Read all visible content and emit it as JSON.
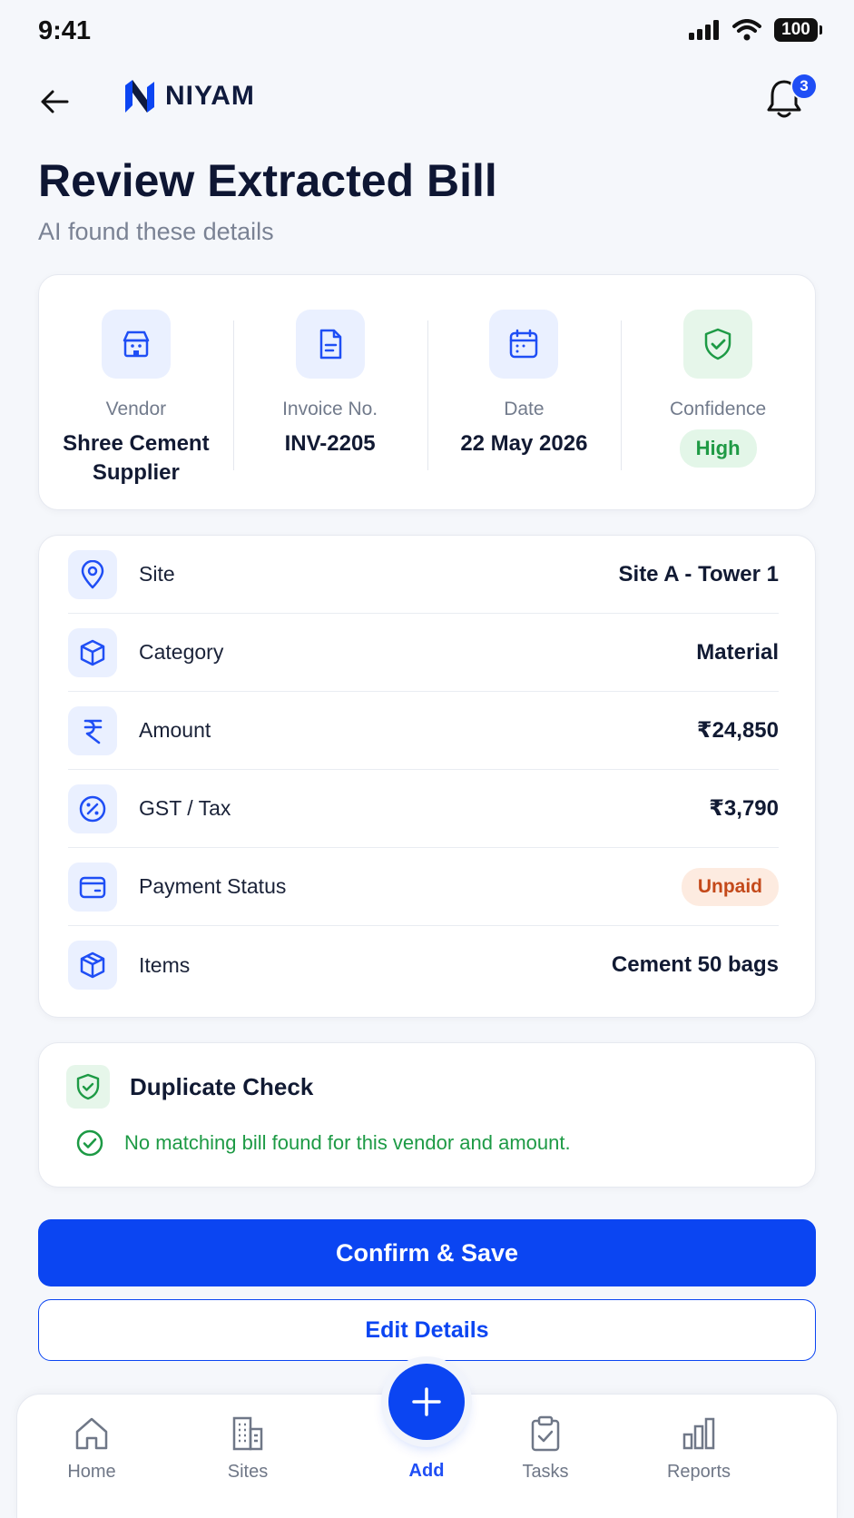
{
  "status_bar": {
    "time": "9:41",
    "battery": "100"
  },
  "header": {
    "brand": "NIYAM",
    "notification_count": "3"
  },
  "page": {
    "title": "Review Extracted Bill",
    "subtitle": "AI found these details"
  },
  "summary": {
    "vendor_label": "Vendor",
    "vendor_value_line1": "Shree Cement",
    "vendor_value_line2": "Supplier",
    "invoice_label": "Invoice No.",
    "invoice_value": "INV-2205",
    "date_label": "Date",
    "date_value": "22 May 2026",
    "confidence_label": "Confidence",
    "confidence_value": "High"
  },
  "details": [
    {
      "label": "Site",
      "value": "Site A - Tower 1",
      "icon": "location-pin-icon"
    },
    {
      "label": "Category",
      "value": "Material",
      "icon": "box-icon"
    },
    {
      "label": "Amount",
      "value": "₹24,850",
      "icon": "rupee-icon"
    },
    {
      "label": "GST / Tax",
      "value": "₹3,790",
      "icon": "percent-icon"
    },
    {
      "label": "Payment Status",
      "value": "Unpaid",
      "icon": "wallet-icon"
    },
    {
      "label": "Items",
      "value": "Cement 50 bags",
      "icon": "package-icon"
    }
  ],
  "duplicate_check": {
    "title": "Duplicate Check",
    "message": "No matching bill found for this vendor and amount."
  },
  "actions": {
    "confirm": "Confirm & Save",
    "edit": "Edit Details"
  },
  "nav": {
    "home": "Home",
    "sites": "Sites",
    "add": "Add",
    "tasks": "Tasks",
    "reports": "Reports"
  },
  "colors": {
    "primary": "#0b45f2",
    "success": "#1d9a45",
    "warning": "#c4491a"
  }
}
